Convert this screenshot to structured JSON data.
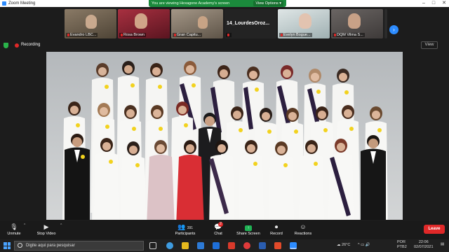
{
  "window": {
    "title": "Zoom Meeting"
  },
  "share_banner": {
    "text": "You are viewing Hexagone Academy's screen",
    "view_options": "View Options ▾"
  },
  "participants_strip": [
    {
      "name": "Evandro LBC...",
      "muted": true,
      "bg": "#6f6250"
    },
    {
      "name": "Rosa Brown",
      "muted": true,
      "bg": "#8b2230"
    },
    {
      "name": "Gran Capitu...",
      "muted": true,
      "bg": "#7a6e60"
    },
    {
      "name": "14_LourdesOroz...",
      "muted": true,
      "text_only": true,
      "bg": "#232323"
    },
    {
      "name": "Evelyn Bogue...",
      "muted": true,
      "bg": "#bcc8c9"
    },
    {
      "name": "DQM Vilma S...",
      "muted": true,
      "bg": "#5d5a59"
    },
    {
      "name": "",
      "muted": false,
      "bg": "#7b6f68"
    }
  ],
  "status": {
    "recording_label": "Recording",
    "view_button": "View"
  },
  "toolbar": {
    "unmute": "Unmute",
    "stop_video": "Stop Video",
    "participants_count": "391",
    "participants": "Participants",
    "chat": "Chat",
    "chat_badge": "2",
    "share_screen": "Share Screen",
    "record": "Record",
    "reactions": "Reactions",
    "leave": "Leave"
  },
  "taskbar": {
    "search_placeholder": "Digite aqui para pesquisar",
    "weather": "26°C",
    "lang": "POR",
    "layout": "PTB2",
    "time": "22:06",
    "date": "02/07/2021"
  },
  "colors": {
    "zoom_blue": "#2d8cff",
    "share_green": "#1b8a3c",
    "leave_red": "#e02828"
  }
}
